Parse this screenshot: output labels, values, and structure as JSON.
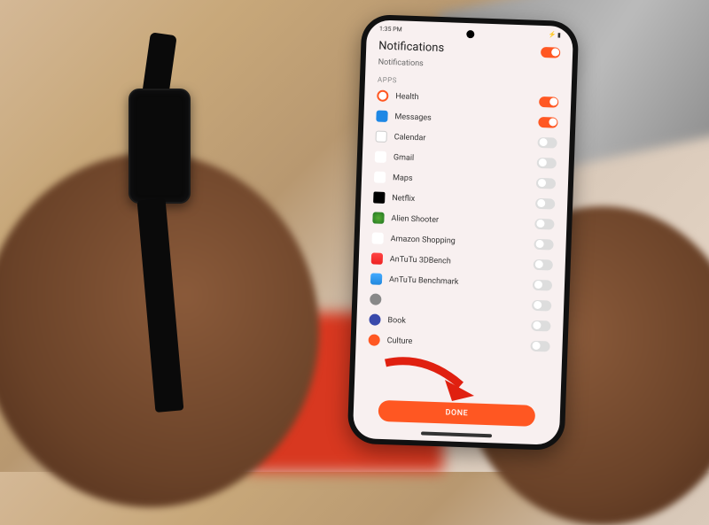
{
  "status_bar": {
    "time": "1:35 PM",
    "right": "⚡ ▮"
  },
  "header": {
    "title": "Notifications",
    "subtitle": "Notifications"
  },
  "section_label": "APPS",
  "apps": [
    {
      "label": "Health",
      "icon": "ic-health",
      "on": true
    },
    {
      "label": "Messages",
      "icon": "ic-messages",
      "on": true
    },
    {
      "label": "Calendar",
      "icon": "ic-calendar",
      "on": false
    },
    {
      "label": "Gmail",
      "icon": "ic-gmail",
      "on": false
    },
    {
      "label": "Maps",
      "icon": "ic-maps",
      "on": false
    },
    {
      "label": "Netflix",
      "icon": "ic-netflix",
      "on": false
    },
    {
      "label": "Alien Shooter",
      "icon": "ic-alien",
      "on": false
    },
    {
      "label": "Amazon Shopping",
      "icon": "ic-amazon",
      "on": false
    },
    {
      "label": "AnTuTu 3DBench",
      "icon": "ic-antutu",
      "on": false
    },
    {
      "label": "AnTuTu Benchmark",
      "icon": "ic-antutu2",
      "on": false
    },
    {
      "label": "",
      "icon": "ic-generic",
      "on": false
    },
    {
      "label": "Book",
      "icon": "ic-book",
      "on": false
    },
    {
      "label": "Culture",
      "icon": "ic-cu",
      "on": false
    }
  ],
  "done_label": "DONE",
  "colors": {
    "accent": "#ff5722"
  }
}
